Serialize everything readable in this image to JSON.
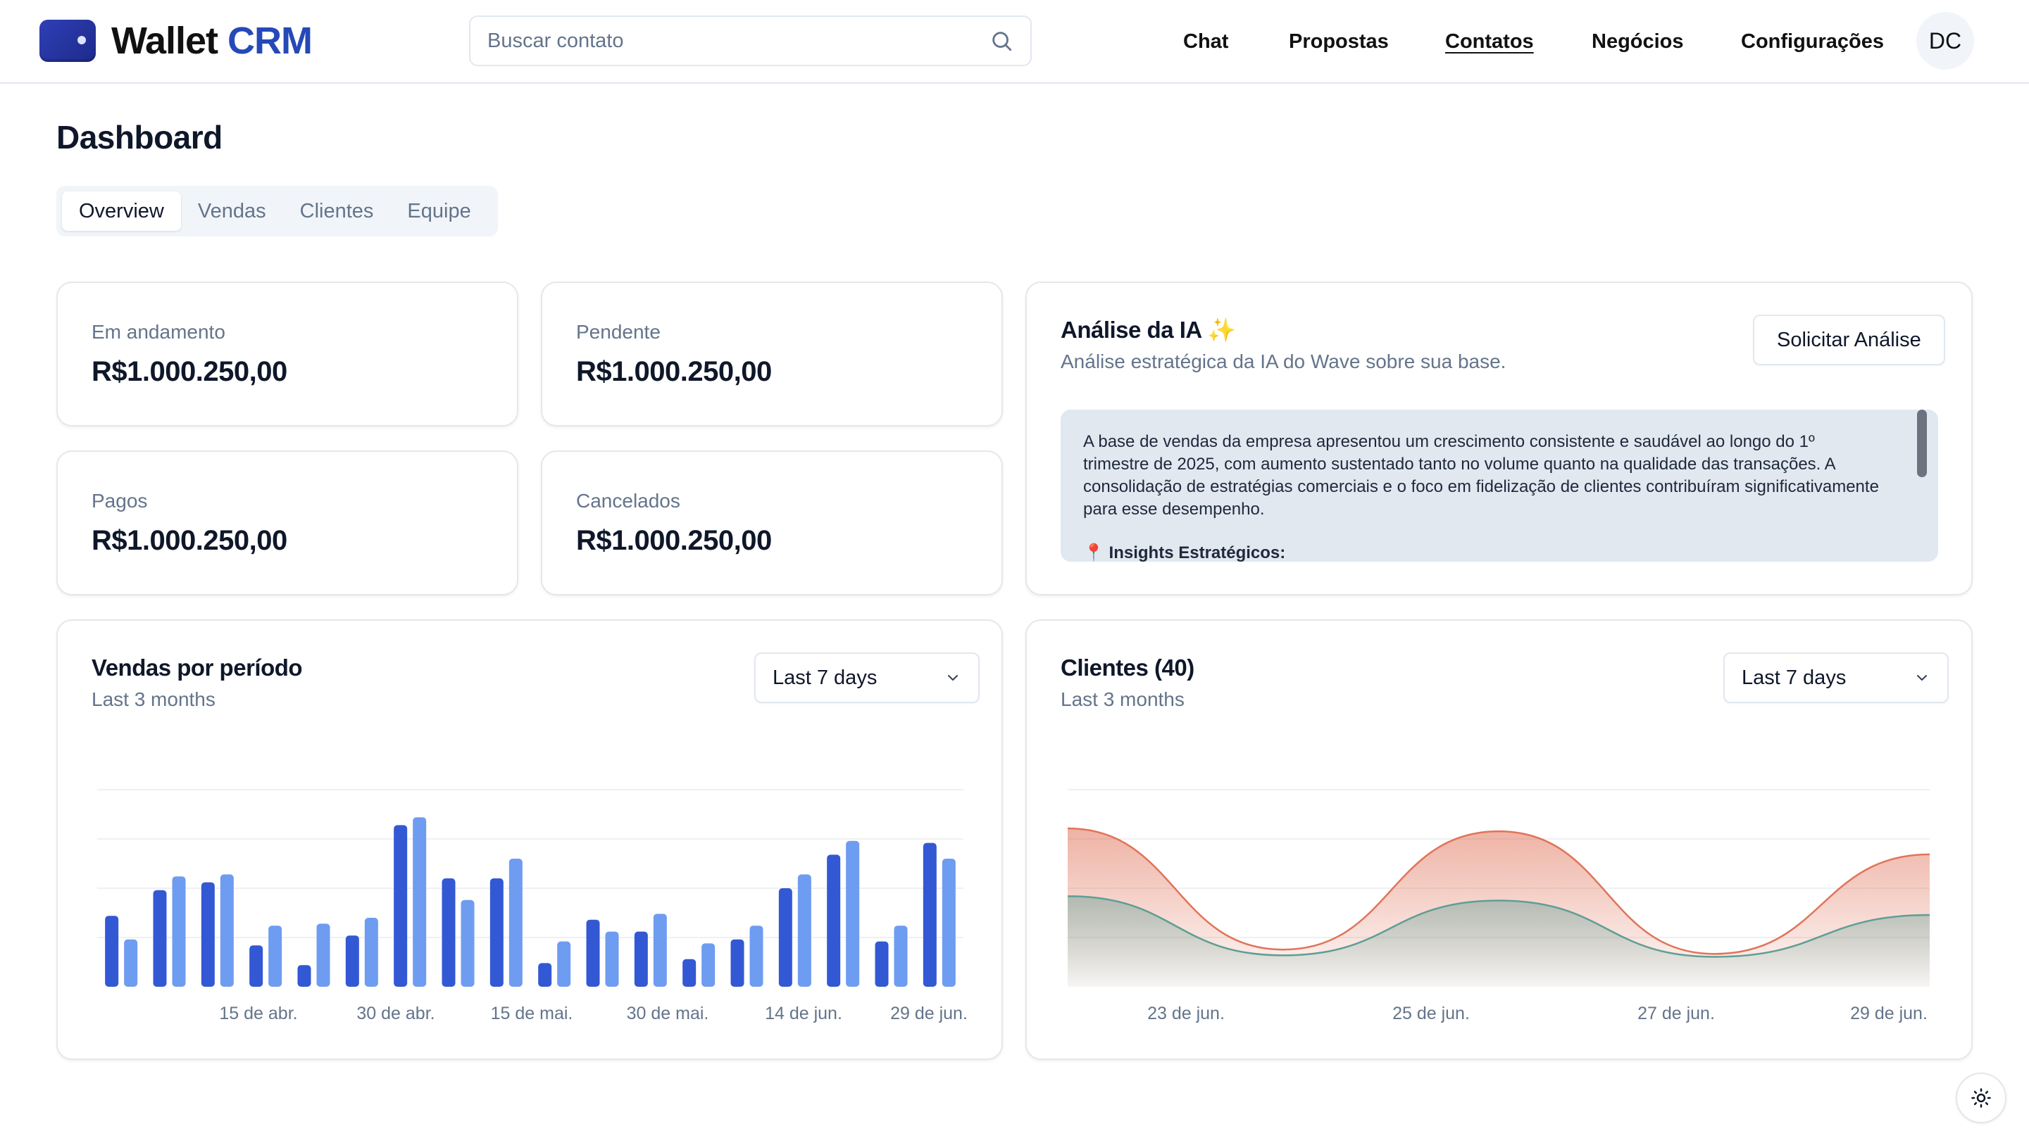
{
  "app": {
    "logo_text": "Wallet",
    "logo_accent": "CRM",
    "brand_color": "#2549b8"
  },
  "search": {
    "placeholder": "Buscar contato",
    "value": ""
  },
  "nav": {
    "chat": "Chat",
    "propostas": "Propostas",
    "contatos": "Contatos",
    "negocios": "Negócios",
    "configuracoes": "Configurações",
    "avatar_initials": "DC",
    "active": "Contatos"
  },
  "page": {
    "title": "Dashboard"
  },
  "tabs": [
    {
      "label": "Overview",
      "active": true
    },
    {
      "label": "Vendas",
      "active": false
    },
    {
      "label": "Clientes",
      "active": false
    },
    {
      "label": "Equipe",
      "active": false
    }
  ],
  "stats": [
    {
      "label": "Em andamento",
      "value": "R$1.000.250,00"
    },
    {
      "label": "Pendente",
      "value": "R$1.000.250,00"
    },
    {
      "label": "Pagos",
      "value": "R$1.000.250,00"
    },
    {
      "label": "Cancelados",
      "value": "R$1.000.250,00"
    }
  ],
  "ai": {
    "title": "Análise da IA ✨",
    "subtitle": "Análise estratégica da IA do Wave sobre sua base.",
    "button": "Solicitar Análise",
    "text": "A base de vendas da empresa apresentou um crescimento consistente e saudável ao longo do 1º trimestre de 2025, com aumento sustentado tanto no volume quanto na qualidade das transações. A consolidação de estratégias comerciais e o foco em fidelização de clientes contribuíram significativamente para esse desempenho.",
    "insights_heading": "📍 Insights Estratégicos:"
  },
  "sales_card": {
    "title": "Vendas por período",
    "subtitle": "Last 3 months",
    "select": "Last 7 days"
  },
  "clients_card": {
    "title": "Clientes (40)",
    "subtitle": "Last 3 months",
    "select": "Last 7 days"
  },
  "chart_data": [
    {
      "type": "bar",
      "x_tick_labels": [
        "15 de abr.",
        "30 de abr.",
        "15 de mai.",
        "30 de mai.",
        "14 de jun.",
        "29 de jun."
      ],
      "grid": true,
      "ylim": [
        0,
        100
      ],
      "series": [
        {
          "color": "#3358d4",
          "values": [
            36,
            49,
            53,
            21,
            11,
            26,
            82,
            55,
            55,
            12,
            34,
            28,
            14,
            24,
            50,
            67,
            23,
            73
          ]
        },
        {
          "color": "#6e9cf0",
          "values": [
            24,
            56,
            57,
            31,
            32,
            35,
            86,
            44,
            65,
            23,
            28,
            37,
            22,
            31,
            57,
            74,
            31,
            65
          ]
        }
      ]
    },
    {
      "type": "area",
      "x_tick_labels": [
        "23 de jun.",
        "25 de jun.",
        "27 de jun.",
        "29 de jun."
      ],
      "grid": true,
      "ylim": [
        0,
        100
      ],
      "series": [
        {
          "color": "#e0745a",
          "values": [
            100,
            16,
            98,
            13,
            82
          ]
        },
        {
          "color": "#5f9e95",
          "values": [
            53,
            12,
            50,
            11,
            40
          ]
        }
      ]
    }
  ]
}
